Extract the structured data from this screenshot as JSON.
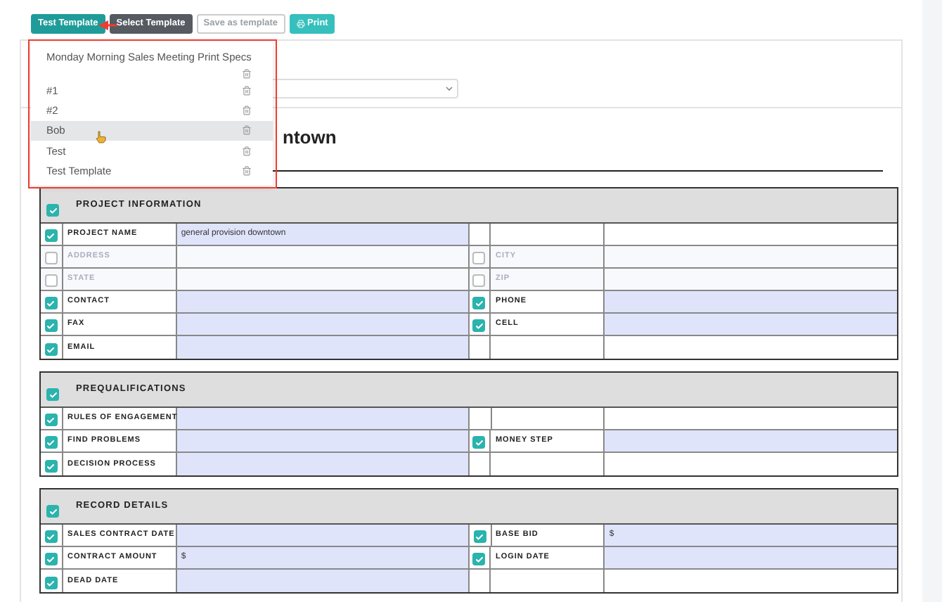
{
  "toolbar": {
    "buttons": [
      {
        "label": "Test Template",
        "kind": "primary"
      },
      {
        "label": "Select Template",
        "kind": "dark"
      },
      {
        "label": "Save as template",
        "kind": "outline"
      },
      {
        "label": "Print",
        "kind": "print"
      }
    ]
  },
  "template_menu": {
    "items": [
      {
        "label": "Monday Morning Sales Meeting Print Specs",
        "selected": false
      },
      {
        "label": "#1",
        "selected": false
      },
      {
        "label": "#2",
        "selected": false
      },
      {
        "label": "Bob",
        "selected": true
      },
      {
        "label": "Test",
        "selected": false
      },
      {
        "label": "Test Template",
        "selected": false
      }
    ]
  },
  "heading": "ntown",
  "sections": [
    {
      "title": "PROJECT INFORMATION",
      "checked": true,
      "rows": [
        {
          "left": {
            "label": "PROJECT NAME",
            "checked": true,
            "value": "general provision downtown"
          }
        },
        {
          "left": {
            "label": "ADDRESS",
            "checked": false
          },
          "right": {
            "label": "CITY",
            "checked": false
          }
        },
        {
          "left": {
            "label": "STATE",
            "checked": false
          },
          "right": {
            "label": "ZIP",
            "checked": false
          }
        },
        {
          "left": {
            "label": "CONTACT",
            "checked": true
          },
          "right": {
            "label": "PHONE",
            "checked": true
          }
        },
        {
          "left": {
            "label": "FAX",
            "checked": true
          },
          "right": {
            "label": "CELL",
            "checked": true
          }
        },
        {
          "left": {
            "label": "EMAIL",
            "checked": true
          }
        }
      ]
    },
    {
      "title": "PREQUALIFICATIONS",
      "checked": true,
      "rows": [
        {
          "left": {
            "label": "RULES OF ENGAGEMENT",
            "checked": true
          }
        },
        {
          "left": {
            "label": "FIND PROBLEMS",
            "checked": true
          },
          "right": {
            "label": "MONEY STEP",
            "checked": true
          }
        },
        {
          "left": {
            "label": "DECISION PROCESS",
            "checked": true
          }
        }
      ]
    },
    {
      "title": "RECORD DETAILS",
      "checked": true,
      "rows": [
        {
          "left": {
            "label": "SALES CONTRACT DATE",
            "checked": true
          },
          "right": {
            "label": "BASE BID",
            "checked": true,
            "value": "$"
          }
        },
        {
          "left": {
            "label": "CONTRACT AMOUNT",
            "checked": true,
            "value": "$"
          },
          "right": {
            "label": "LOGIN DATE",
            "checked": true
          }
        },
        {
          "left": {
            "label": "DEAD DATE",
            "checked": true
          }
        }
      ]
    }
  ]
}
